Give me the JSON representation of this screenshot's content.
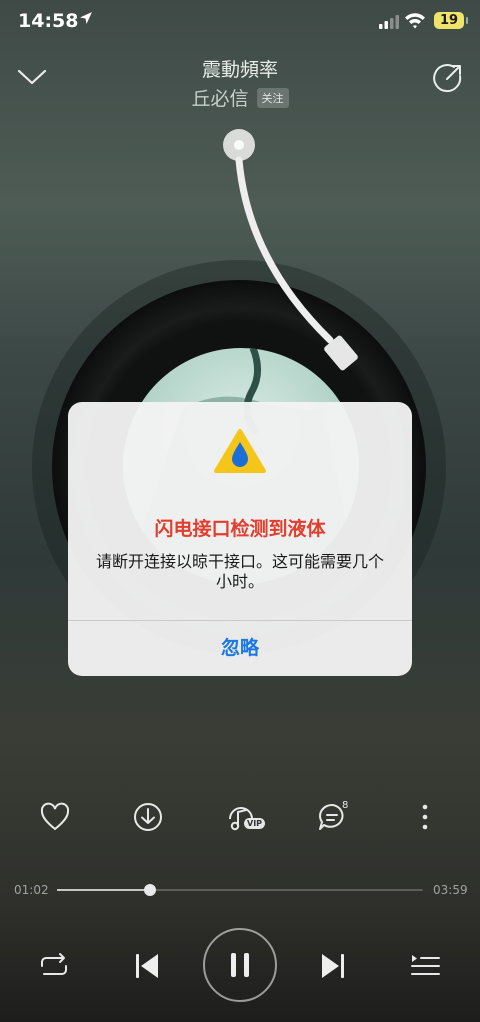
{
  "status_bar": {
    "time": "14:58",
    "battery": "19"
  },
  "header": {
    "song_title": "震動頻率",
    "artist": "丘必信",
    "follow_label": "关注"
  },
  "alert": {
    "title": "闪电接口检测到液体",
    "message": "请断开连接以晾干接口。这可能需要几个小时。",
    "button_label": "忽略",
    "icon": "water-warning-icon"
  },
  "actions": {
    "comment_count": "8",
    "vip_label": "VIP",
    "items": [
      "heart-icon",
      "download-icon",
      "vip-music-icon",
      "comment-icon",
      "more-icon"
    ]
  },
  "progress": {
    "current": "01:02",
    "total": "03:59",
    "fraction": 0.253
  },
  "controls": [
    "repeat-icon",
    "previous-icon",
    "pause-icon",
    "next-icon",
    "playlist-icon"
  ],
  "colors": {
    "alert_title": "#e33d2e",
    "alert_button": "#1b78e0",
    "battery": "#efe36a"
  }
}
